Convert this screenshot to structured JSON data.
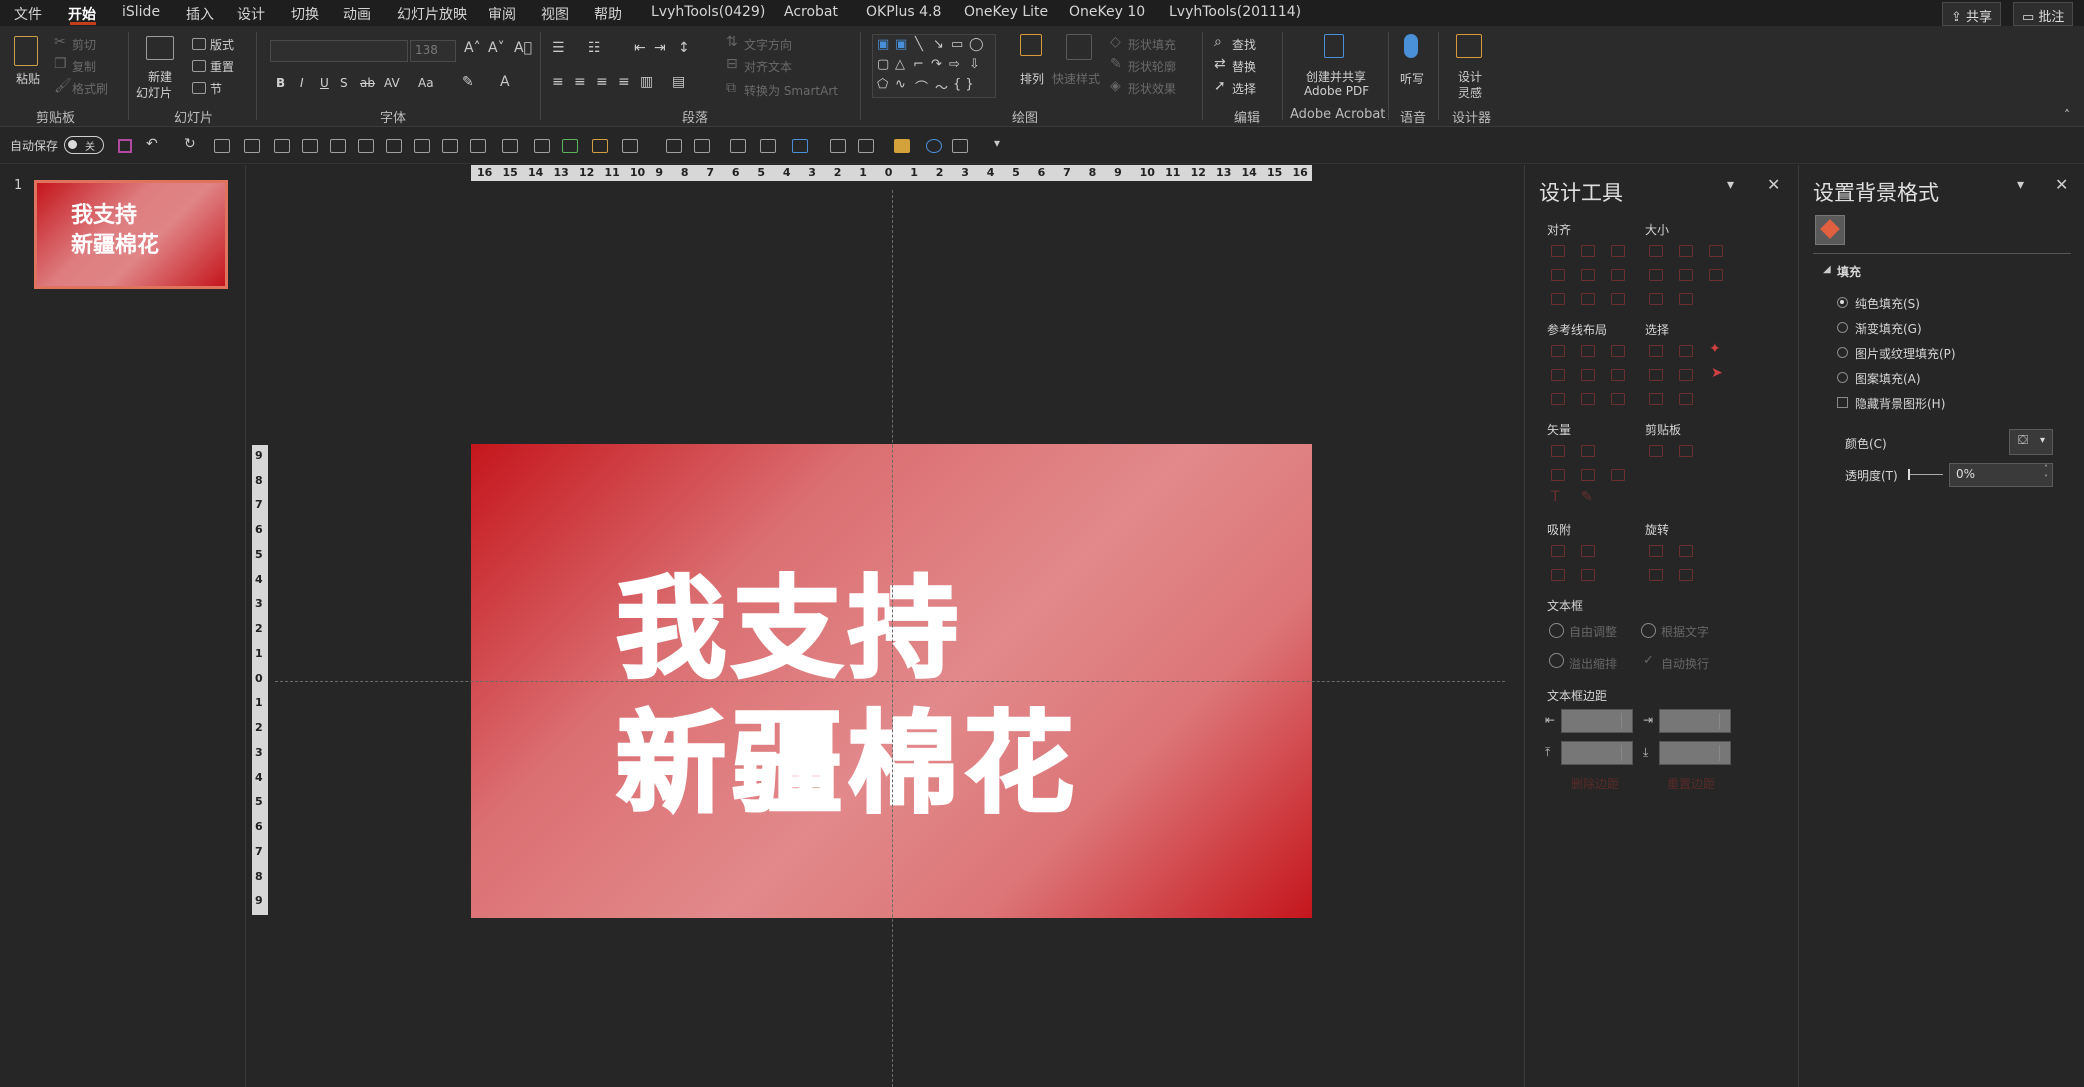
{
  "menu": {
    "items": [
      "文件",
      "开始",
      "iSlide",
      "插入",
      "设计",
      "切换",
      "动画",
      "幻灯片放映",
      "审阅",
      "视图",
      "帮助",
      "LvyhTools(0429)",
      "Acrobat",
      "OKPlus 4.8",
      "OneKey Lite",
      "OneKey 10",
      "LvyhTools(201114)"
    ],
    "share": "共享",
    "comment": "批注"
  },
  "ribbon": {
    "clipboard": {
      "paste": "粘贴",
      "cut": "剪切",
      "copy": "复制",
      "format_painter": "格式刷",
      "label": "剪贴板"
    },
    "slides": {
      "new_slide": "新建",
      "new_slide2": "幻灯片",
      "layout": "版式",
      "reset": "重置",
      "section": "节",
      "label": "幻灯片"
    },
    "font": {
      "size": "138",
      "label": "字体",
      "bold": "B",
      "italic": "I",
      "underline": "U",
      "shadow": "S",
      "strike": "ab",
      "spacing": "AV",
      "case": "Aa"
    },
    "paragraph": {
      "text_direction": "文字方向",
      "align_text": "对齐文本",
      "smartart": "转换为 SmartArt",
      "label": "段落"
    },
    "drawing": {
      "arrange": "排列",
      "quick_styles": "快速样式",
      "shape_fill": "形状填充",
      "shape_outline": "形状轮廓",
      "shape_effects": "形状效果",
      "label": "绘图"
    },
    "editing": {
      "find": "查找",
      "replace": "替换",
      "select": "选择",
      "label": "编辑"
    },
    "acrobat": {
      "create_share": "创建并共享",
      "adobe_pdf": "Adobe PDF",
      "label": "Adobe Acrobat"
    },
    "voice": {
      "dictate": "听写",
      "label": "语音"
    },
    "designer": {
      "design": "设计",
      "ideas": "灵感",
      "label": "设计器"
    }
  },
  "qat": {
    "autosave": "自动保存",
    "autosave_state": "关"
  },
  "thumbnails": [
    {
      "number": "1",
      "line1": "我支持",
      "line2": "新疆棉花"
    }
  ],
  "slide": {
    "line1": "我支持",
    "line2": "新疆棉花"
  },
  "rulers": {
    "horizontal": [
      "16",
      "15",
      "14",
      "13",
      "12",
      "11",
      "10",
      "9",
      "8",
      "7",
      "6",
      "5",
      "4",
      "3",
      "2",
      "1",
      "0",
      "1",
      "2",
      "3",
      "4",
      "5",
      "6",
      "7",
      "8",
      "9",
      "10",
      "11",
      "12",
      "13",
      "14",
      "15",
      "16"
    ],
    "vertical": [
      "9",
      "8",
      "7",
      "6",
      "5",
      "4",
      "3",
      "2",
      "1",
      "0",
      "1",
      "2",
      "3",
      "4",
      "5",
      "6",
      "7",
      "8",
      "9"
    ]
  },
  "design_tools": {
    "title": "设计工具",
    "sections": {
      "align": "对齐",
      "size": "大小",
      "guides": "参考线布局",
      "select": "选择",
      "vector": "矢量",
      "clipboard": "剪贴板",
      "snap": "吸附",
      "rotate": "旋转",
      "textbox": "文本框",
      "margins": "文本框边距"
    },
    "autofit": "自由调整",
    "fit_text": "根据文字",
    "overflow": "溢出缩排",
    "autowrap": "自动换行",
    "delete_margin": "删除边距",
    "reset_margin": "重置边距"
  },
  "format_background": {
    "title": "设置背景格式",
    "fill_header": "填充",
    "options": [
      "纯色填充(S)",
      "渐变填充(G)",
      "图片或纹理填充(P)",
      "图案填充(A)"
    ],
    "selected_option": "纯色填充(S)",
    "hide_bg": "隐藏背景图形(H)",
    "color_label": "颜色(C)",
    "transparency_label": "透明度(T)",
    "transparency_value": "0%"
  },
  "colors": {
    "accent": "#c43e1c",
    "slide_red": "#c4161c",
    "slide_pink": "#e2898b"
  }
}
